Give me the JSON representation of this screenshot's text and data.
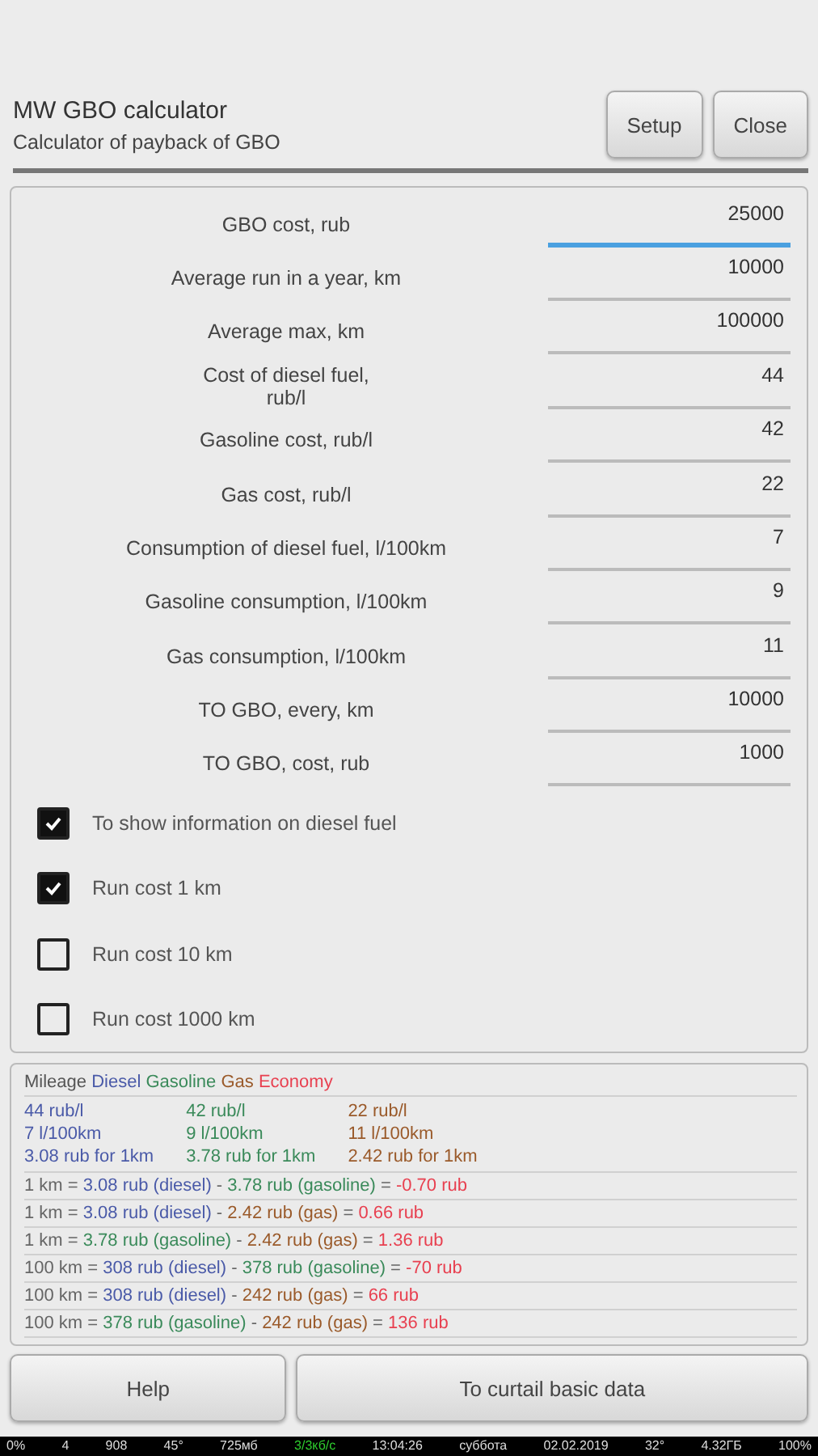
{
  "header": {
    "title": "MW GBO calculator",
    "subtitle": "Calculator of payback of GBO",
    "buttons": [
      "Setup",
      "Close"
    ]
  },
  "fields": [
    {
      "label": "GBO cost, rub",
      "value": "25000",
      "focused": true
    },
    {
      "label": "Average run in a year, km",
      "value": "10000",
      "focused": false
    },
    {
      "label": "Average max, km",
      "value": "100000",
      "focused": false
    },
    {
      "label": "Cost of diesel fuel,\nrub/l",
      "value": "44",
      "focused": false
    },
    {
      "label": "Gasoline cost, rub/l",
      "value": "42",
      "focused": false
    },
    {
      "label": "Gas cost, rub/l",
      "value": "22",
      "focused": false
    },
    {
      "label": "Consumption of diesel fuel, l/100km",
      "value": "7",
      "focused": false
    },
    {
      "label": "Gasoline consumption, l/100km",
      "value": "9",
      "focused": false
    },
    {
      "label": "Gas consumption, l/100km",
      "value": "11",
      "focused": false
    },
    {
      "label": "TO GBO, every, km",
      "value": "10000",
      "focused": false
    },
    {
      "label": "TO GBO, cost, rub",
      "value": "1000",
      "focused": false
    }
  ],
  "checkboxes": [
    {
      "label": "To show information on diesel fuel",
      "checked": true
    },
    {
      "label": "Run cost 1 km",
      "checked": true
    },
    {
      "label": "Run cost 10 km",
      "checked": false
    },
    {
      "label": "Run cost 1000 km",
      "checked": false
    }
  ],
  "results": {
    "legend": [
      {
        "text": "Mileage",
        "color": "#555555"
      },
      {
        "text": "Diesel",
        "color": "#4a5aa8"
      },
      {
        "text": "Gasoline",
        "color": "#3a8a5a"
      },
      {
        "text": "Gas",
        "color": "#9a5a2a"
      },
      {
        "text": "Economy",
        "color": "#e84050"
      }
    ],
    "summary_columns": [
      {
        "color": "#4a5aa8",
        "lines": [
          "44 rub/l",
          "7 l/100km",
          "3.08 rub for 1km"
        ]
      },
      {
        "color": "#3a8a5a",
        "lines": [
          "42 rub/l",
          "9 l/100km",
          "3.78 rub for 1km"
        ]
      },
      {
        "color": "#9a5a2a",
        "lines": [
          "22 rub/l",
          "11 l/100km",
          "2.42 rub for 1km"
        ]
      }
    ],
    "lines": [
      [
        {
          "text": "1 km = ",
          "color": "#666666"
        },
        {
          "text": "3.08 rub (diesel)",
          "color": "#4a5aa8"
        },
        {
          "text": " - ",
          "color": "#666666"
        },
        {
          "text": "3.78 rub (gasoline)",
          "color": "#3a8a5a"
        },
        {
          "text": " = ",
          "color": "#666666"
        },
        {
          "text": "-0.70 rub",
          "color": "#e84050"
        }
      ],
      [
        {
          "text": "1 km = ",
          "color": "#666666"
        },
        {
          "text": "3.08 rub (diesel)",
          "color": "#4a5aa8"
        },
        {
          "text": " - ",
          "color": "#666666"
        },
        {
          "text": "2.42 rub (gas)",
          "color": "#9a5a2a"
        },
        {
          "text": " = ",
          "color": "#666666"
        },
        {
          "text": "0.66 rub",
          "color": "#e84050"
        }
      ],
      [
        {
          "text": "1 km = ",
          "color": "#666666"
        },
        {
          "text": "3.78 rub (gasoline)",
          "color": "#3a8a5a"
        },
        {
          "text": " - ",
          "color": "#666666"
        },
        {
          "text": "2.42 rub (gas)",
          "color": "#9a5a2a"
        },
        {
          "text": " = ",
          "color": "#666666"
        },
        {
          "text": "1.36 rub",
          "color": "#e84050"
        }
      ],
      [
        {
          "text": "100 km = ",
          "color": "#666666"
        },
        {
          "text": "308 rub (diesel)",
          "color": "#4a5aa8"
        },
        {
          "text": " - ",
          "color": "#666666"
        },
        {
          "text": "378 rub (gasoline)",
          "color": "#3a8a5a"
        },
        {
          "text": " = ",
          "color": "#666666"
        },
        {
          "text": "-70 rub",
          "color": "#e84050"
        }
      ],
      [
        {
          "text": "100 km = ",
          "color": "#666666"
        },
        {
          "text": "308 rub (diesel)",
          "color": "#4a5aa8"
        },
        {
          "text": " - ",
          "color": "#666666"
        },
        {
          "text": "242 rub (gas)",
          "color": "#9a5a2a"
        },
        {
          "text": " = ",
          "color": "#666666"
        },
        {
          "text": "66 rub",
          "color": "#e84050"
        }
      ],
      [
        {
          "text": "100 km = ",
          "color": "#666666"
        },
        {
          "text": "378 rub (gasoline)",
          "color": "#3a8a5a"
        },
        {
          "text": " - ",
          "color": "#666666"
        },
        {
          "text": "242 rub (gas)",
          "color": "#9a5a2a"
        },
        {
          "text": " = ",
          "color": "#666666"
        },
        {
          "text": "136 rub",
          "color": "#e84050"
        }
      ]
    ]
  },
  "footer_buttons": [
    "Help",
    "To curtail basic data"
  ],
  "status_bar": [
    {
      "text": "0%",
      "kind": "plain"
    },
    {
      "text": "4",
      "kind": "plain"
    },
    {
      "text": "908",
      "kind": "plain"
    },
    {
      "text": "45°",
      "kind": "plain"
    },
    {
      "text": "725мб",
      "kind": "plain"
    },
    {
      "text": "3/3кб/с",
      "kind": "network"
    },
    {
      "text": "13:04:26",
      "kind": "plain"
    },
    {
      "text": "суббота",
      "kind": "plain"
    },
    {
      "text": "02.02.2019",
      "kind": "plain"
    },
    {
      "text": "32°",
      "kind": "plain"
    },
    {
      "text": "4.32ГБ",
      "kind": "plain"
    },
    {
      "text": "100%",
      "kind": "plain"
    }
  ]
}
